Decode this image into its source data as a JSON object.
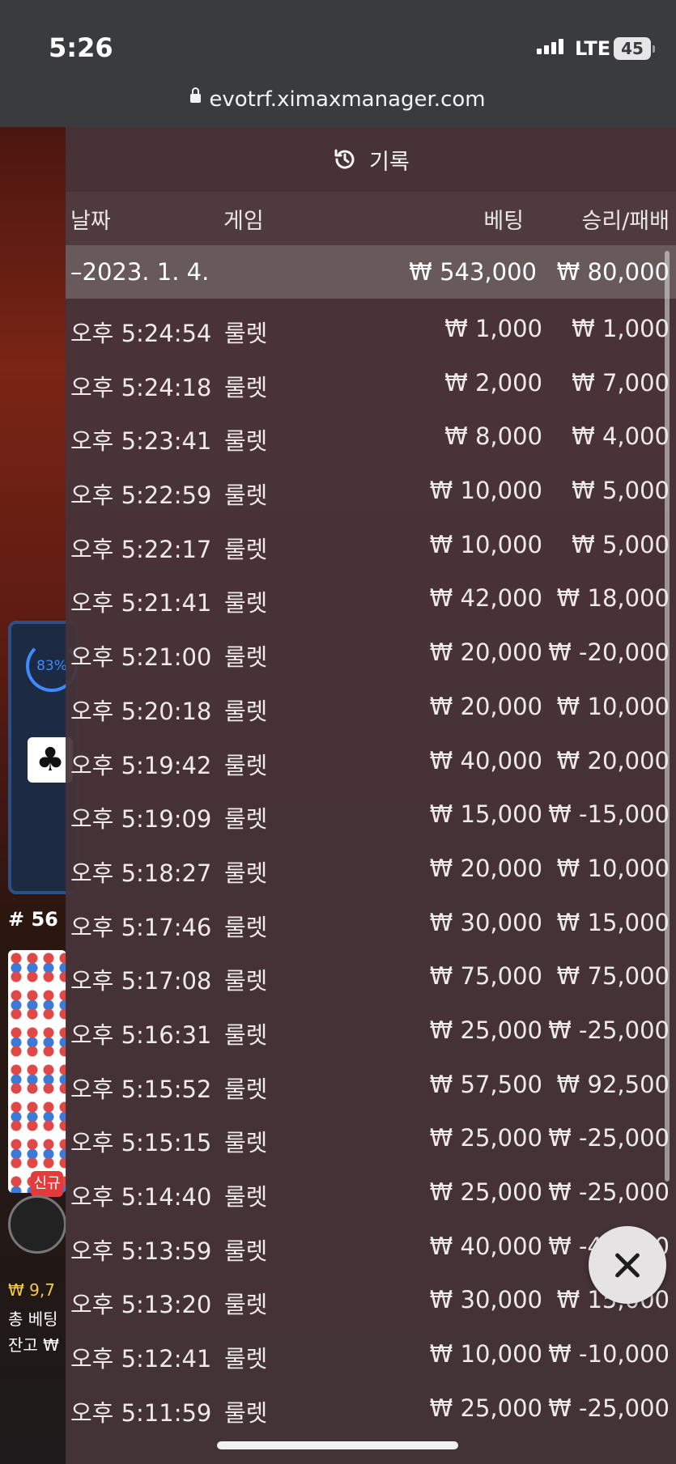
{
  "status_bar": {
    "time": "5:26",
    "network": "LTE",
    "battery": "45"
  },
  "browser": {
    "url": "evotrf.ximaxmanager.com"
  },
  "background": {
    "percent": "83%",
    "round_label": "# 56",
    "new_badge": "신규",
    "balance_line": "₩ 9,7",
    "total_bet_label": "총 베팅",
    "balance_label": "잔고 ₩"
  },
  "history": {
    "title": "기록",
    "icon": "history-icon",
    "columns": {
      "date": "날짜",
      "game": "게임",
      "bet": "베팅",
      "result": "승리/패배"
    },
    "date_group": {
      "date": "–2023. 1. 4.",
      "bet_total": "₩ 543,000",
      "result_total": "₩ 80,000"
    },
    "rows": [
      {
        "time": "오후 5:24:54",
        "game": "룰렛",
        "bet": "₩ 1,000",
        "result": "₩ 1,000"
      },
      {
        "time": "오후 5:24:18",
        "game": "룰렛",
        "bet": "₩ 2,000",
        "result": "₩ 7,000"
      },
      {
        "time": "오후 5:23:41",
        "game": "룰렛",
        "bet": "₩ 8,000",
        "result": "₩ 4,000"
      },
      {
        "time": "오후 5:22:59",
        "game": "룰렛",
        "bet": "₩ 10,000",
        "result": "₩ 5,000"
      },
      {
        "time": "오후 5:22:17",
        "game": "룰렛",
        "bet": "₩ 10,000",
        "result": "₩ 5,000"
      },
      {
        "time": "오후 5:21:41",
        "game": "룰렛",
        "bet": "₩ 42,000",
        "result": "₩ 18,000"
      },
      {
        "time": "오후 5:21:00",
        "game": "룰렛",
        "bet": "₩ 20,000",
        "result": "₩ -20,000"
      },
      {
        "time": "오후 5:20:18",
        "game": "룰렛",
        "bet": "₩ 20,000",
        "result": "₩ 10,000"
      },
      {
        "time": "오후 5:19:42",
        "game": "룰렛",
        "bet": "₩ 40,000",
        "result": "₩ 20,000"
      },
      {
        "time": "오후 5:19:09",
        "game": "룰렛",
        "bet": "₩ 15,000",
        "result": "₩ -15,000"
      },
      {
        "time": "오후 5:18:27",
        "game": "룰렛",
        "bet": "₩ 20,000",
        "result": "₩ 10,000"
      },
      {
        "time": "오후 5:17:46",
        "game": "룰렛",
        "bet": "₩ 30,000",
        "result": "₩ 15,000"
      },
      {
        "time": "오후 5:17:08",
        "game": "룰렛",
        "bet": "₩ 75,000",
        "result": "₩ 75,000"
      },
      {
        "time": "오후 5:16:31",
        "game": "룰렛",
        "bet": "₩ 25,000",
        "result": "₩ -25,000"
      },
      {
        "time": "오후 5:15:52",
        "game": "룰렛",
        "bet": "₩ 57,500",
        "result": "₩ 92,500"
      },
      {
        "time": "오후 5:15:15",
        "game": "룰렛",
        "bet": "₩ 25,000",
        "result": "₩ -25,000"
      },
      {
        "time": "오후 5:14:40",
        "game": "룰렛",
        "bet": "₩ 25,000",
        "result": "₩ -25,000"
      },
      {
        "time": "오후 5:13:59",
        "game": "룰렛",
        "bet": "₩ 40,000",
        "result": "₩ -40,000"
      },
      {
        "time": "오후 5:13:20",
        "game": "룰렛",
        "bet": "₩ 30,000",
        "result": "₩ 15,000"
      },
      {
        "time": "오후 5:12:41",
        "game": "룰렛",
        "bet": "₩ 10,000",
        "result": "₩ -10,000"
      },
      {
        "time": "오후 5:11:59",
        "game": "룰렛",
        "bet": "₩ 25,000",
        "result": "₩ -25,000"
      }
    ],
    "close_icon": "close-icon"
  }
}
